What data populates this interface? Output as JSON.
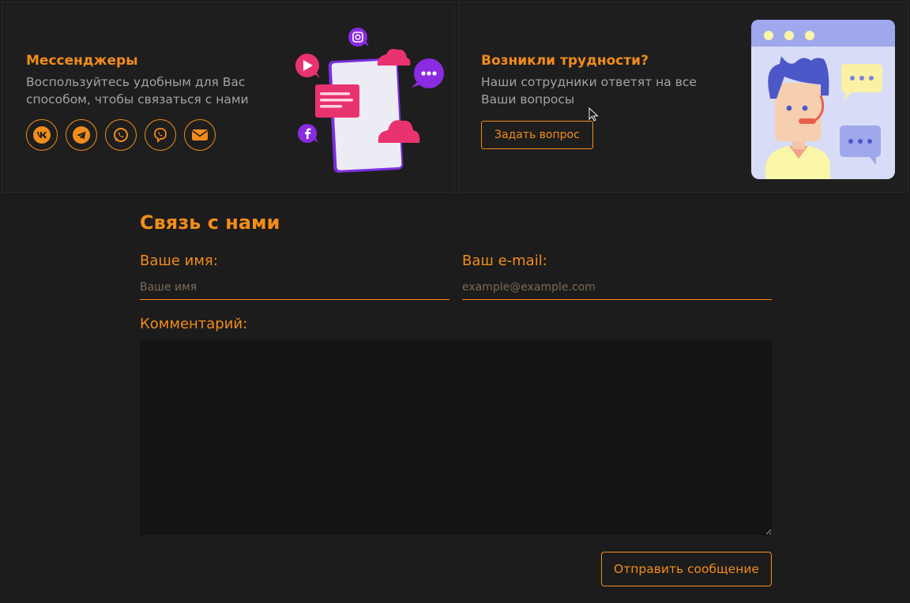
{
  "messengers": {
    "title": "Мессенджеры",
    "description": "Воспользуйтесь удобным для Вас способом, чтобы связаться с нами",
    "social": [
      {
        "icon": "vk-icon"
      },
      {
        "icon": "telegram-icon"
      },
      {
        "icon": "whatsapp-icon"
      },
      {
        "icon": "viber-icon"
      },
      {
        "icon": "mail-icon"
      }
    ]
  },
  "support": {
    "title": "Возникли трудности?",
    "description": "Наши сотрудники ответят на все Ваши вопросы",
    "button_label": "Задать вопрос"
  },
  "contact": {
    "title": "Связь с нами",
    "name_label": "Ваше имя:",
    "name_placeholder": "Ваше имя",
    "email_label": "Ваш e-mail:",
    "email_placeholder": "example@example.com",
    "comment_label": "Комментарий:",
    "submit_label": "Отправить сообщение"
  },
  "colors": {
    "accent": "#f28c1c",
    "background": "#1c1c1c"
  }
}
